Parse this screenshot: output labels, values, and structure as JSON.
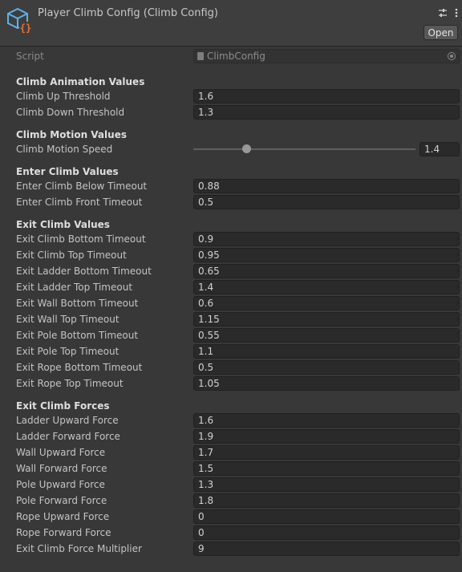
{
  "header": {
    "title": "Player Climb Config (Climb Config)",
    "open_label": "Open"
  },
  "script": {
    "label": "Script",
    "value": "ClimbConfig"
  },
  "sections": [
    {
      "title": "Climb Animation Values",
      "fields": [
        {
          "label": "Climb Up Threshold",
          "value": "1.6"
        },
        {
          "label": "Climb Down Threshold",
          "value": "1.3"
        }
      ]
    },
    {
      "title": "Climb Motion Values",
      "slider": {
        "label": "Climb Motion Speed",
        "value": "1.4",
        "fraction": 0.24
      }
    },
    {
      "title": "Enter Climb Values",
      "fields": [
        {
          "label": "Enter Climb Below Timeout",
          "value": "0.88"
        },
        {
          "label": "Enter Climb Front Timeout",
          "value": "0.5"
        }
      ]
    },
    {
      "title": "Exit Climb Values",
      "fields": [
        {
          "label": "Exit Climb Bottom Timeout",
          "value": "0.9"
        },
        {
          "label": "Exit Climb Top Timeout",
          "value": "0.95"
        },
        {
          "label": "Exit Ladder Bottom Timeout",
          "value": "0.65"
        },
        {
          "label": "Exit Ladder Top Timeout",
          "value": "1.4"
        },
        {
          "label": "Exit Wall Bottom Timeout",
          "value": "0.6"
        },
        {
          "label": "Exit Wall Top Timeout",
          "value": "1.15"
        },
        {
          "label": "Exit Pole Bottom Timeout",
          "value": "0.55"
        },
        {
          "label": "Exit Pole Top Timeout",
          "value": "1.1"
        },
        {
          "label": "Exit Rope Bottom Timeout",
          "value": "0.5"
        },
        {
          "label": "Exit Rope Top Timeout",
          "value": "1.05"
        }
      ]
    },
    {
      "title": "Exit Climb Forces",
      "fields": [
        {
          "label": "Ladder Upward Force",
          "value": "1.6"
        },
        {
          "label": "Ladder Forward Force",
          "value": "1.9"
        },
        {
          "label": "Wall Upward Force",
          "value": "1.7"
        },
        {
          "label": "Wall Forward Force",
          "value": "1.5"
        },
        {
          "label": "Pole Upward Force",
          "value": "1.3"
        },
        {
          "label": "Pole Forward Force",
          "value": "1.8"
        },
        {
          "label": "Rope Upward Force",
          "value": "0"
        },
        {
          "label": "Rope Forward Force",
          "value": "0"
        },
        {
          "label": "Exit Climb Force Multiplier",
          "value": "9"
        }
      ]
    }
  ],
  "icons": {
    "asset": "scriptable-object-cube-icon",
    "settings": "sliders-icon",
    "menu": "kebab-menu-icon",
    "script_file": "script-file-icon",
    "object_picker": "object-picker-target-icon"
  },
  "colors": {
    "background": "#383838",
    "header": "#3e3e3e",
    "field": "#2a2a2a",
    "asset_icon_blue": "#5fb0e8",
    "asset_icon_orange": "#e8733a"
  }
}
